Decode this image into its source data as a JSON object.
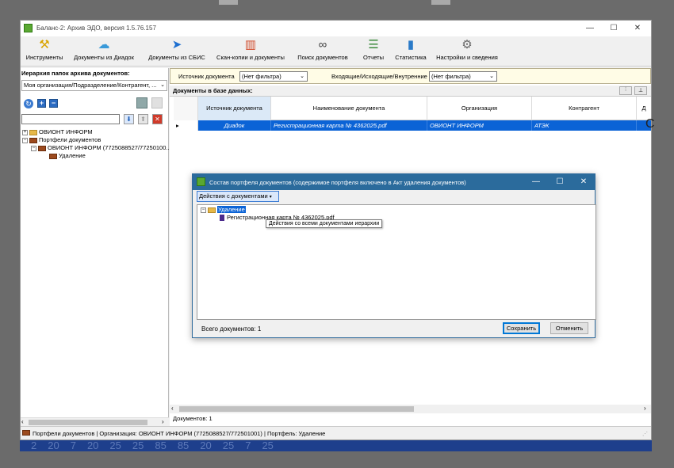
{
  "window": {
    "title": "Баланс-2: Архив ЭДО, версия 1.5.76.157",
    "minimize": "—",
    "maximize": "☐",
    "close": "✕"
  },
  "toolbar": {
    "items": [
      {
        "label": "Инструменты",
        "icon": "tools-icon"
      },
      {
        "label": "Документы из Диадок",
        "icon": "cloud-icon"
      },
      {
        "label": "Документы из СБИС",
        "icon": "bird-icon"
      },
      {
        "label": "Скан-копии и документы",
        "icon": "binders-icon"
      },
      {
        "label": "Поиск документов",
        "icon": "binoculars-icon"
      },
      {
        "label": "Отчеты",
        "icon": "report-icon"
      },
      {
        "label": "Статистика",
        "icon": "chart-icon"
      },
      {
        "label": "Настройки и сведения",
        "icon": "gear-icon"
      }
    ]
  },
  "left": {
    "header": "Иерархия папок архива документов:",
    "combo": "Моя организация/Подразделение/Контрагент, ...",
    "tree": [
      {
        "label": "ОВИОНТ ИНФОРМ",
        "kind": "folder",
        "level": 0,
        "expander": "+"
      },
      {
        "label": "Портфели документов",
        "kind": "brief",
        "level": 0,
        "expander": "−"
      },
      {
        "label": "ОВИОНТ ИНФОРМ (7725088527/77250100...",
        "kind": "brief",
        "level": 1,
        "expander": "−"
      },
      {
        "label": "Удаление",
        "kind": "brief",
        "level": 2,
        "expander": ""
      }
    ]
  },
  "right": {
    "filter": {
      "source_label": "Источник документа",
      "source_value": "(Нет фильтра)",
      "direction_label": "Входящие/Исходящие/Внутренние",
      "direction_value": "(Нет фильтра)"
    },
    "db_header": "Документы в базе данных:",
    "columns": [
      "Источник документа",
      "Наименование документа",
      "Организация",
      "Контрагент",
      "Д"
    ],
    "rows": [
      {
        "source": "Диадок",
        "name": "Регистрационная карта № 4362025.pdf",
        "org": "ОВИОНТ ИНФОРМ",
        "contractor": "АТЭК"
      }
    ],
    "count": "Документов: 1"
  },
  "status": "Портфели документов | Организация: ОВИОНТ ИНФОРМ (7725088527/772501001) | Портфель: Удаление",
  "dialog": {
    "title": "Состав портфеля документов (содержимое портфеля включено в Акт удаления документов)",
    "menu": "Действия с документами",
    "tree_root": "Удаление",
    "tree_child": "Регистрационная карта № 4362025.pdf",
    "tooltip": "Действия со всеми документами иерархии",
    "total": "Всего документов: 1",
    "save": "Сохранить",
    "cancel": "Отменить"
  },
  "colors": {
    "accent": "#0b63d6",
    "dialog_title": "#2b6b9c",
    "filter_bg": "#fffce6"
  }
}
